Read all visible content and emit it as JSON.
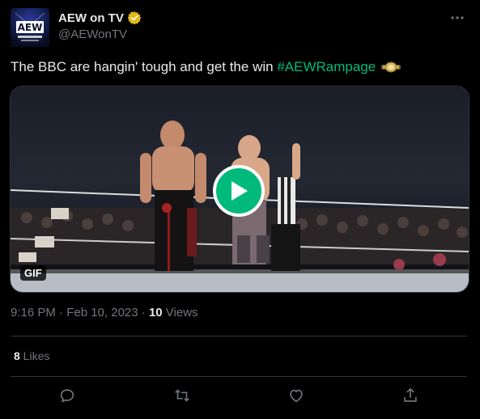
{
  "author": {
    "display_name": "AEW on TV",
    "handle": "@AEWonTV",
    "avatar_text": "AEW"
  },
  "tweet": {
    "text": "The BBC are hangin' tough and get the win ",
    "hashtag": "#AEWRampage"
  },
  "media": {
    "badge": "GIF"
  },
  "meta": {
    "time": "9:16 PM · Feb 10, 2023",
    "separator": " · ",
    "views_count": "10",
    "views_label": " Views"
  },
  "stats": {
    "likes_count": "8",
    "likes_label": " Likes"
  },
  "colors": {
    "background": "#000000",
    "text": "#e7e9ea",
    "secondary": "#71767b",
    "hashtag": "#00ba7c",
    "play": "#00ba7c",
    "verified": "#e2b719",
    "divider": "#2f3336"
  },
  "icons": [
    "verified-badge-icon",
    "more-icon",
    "play-icon",
    "reply-icon",
    "retweet-icon",
    "like-icon",
    "share-icon",
    "belt-emoji-icon"
  ]
}
